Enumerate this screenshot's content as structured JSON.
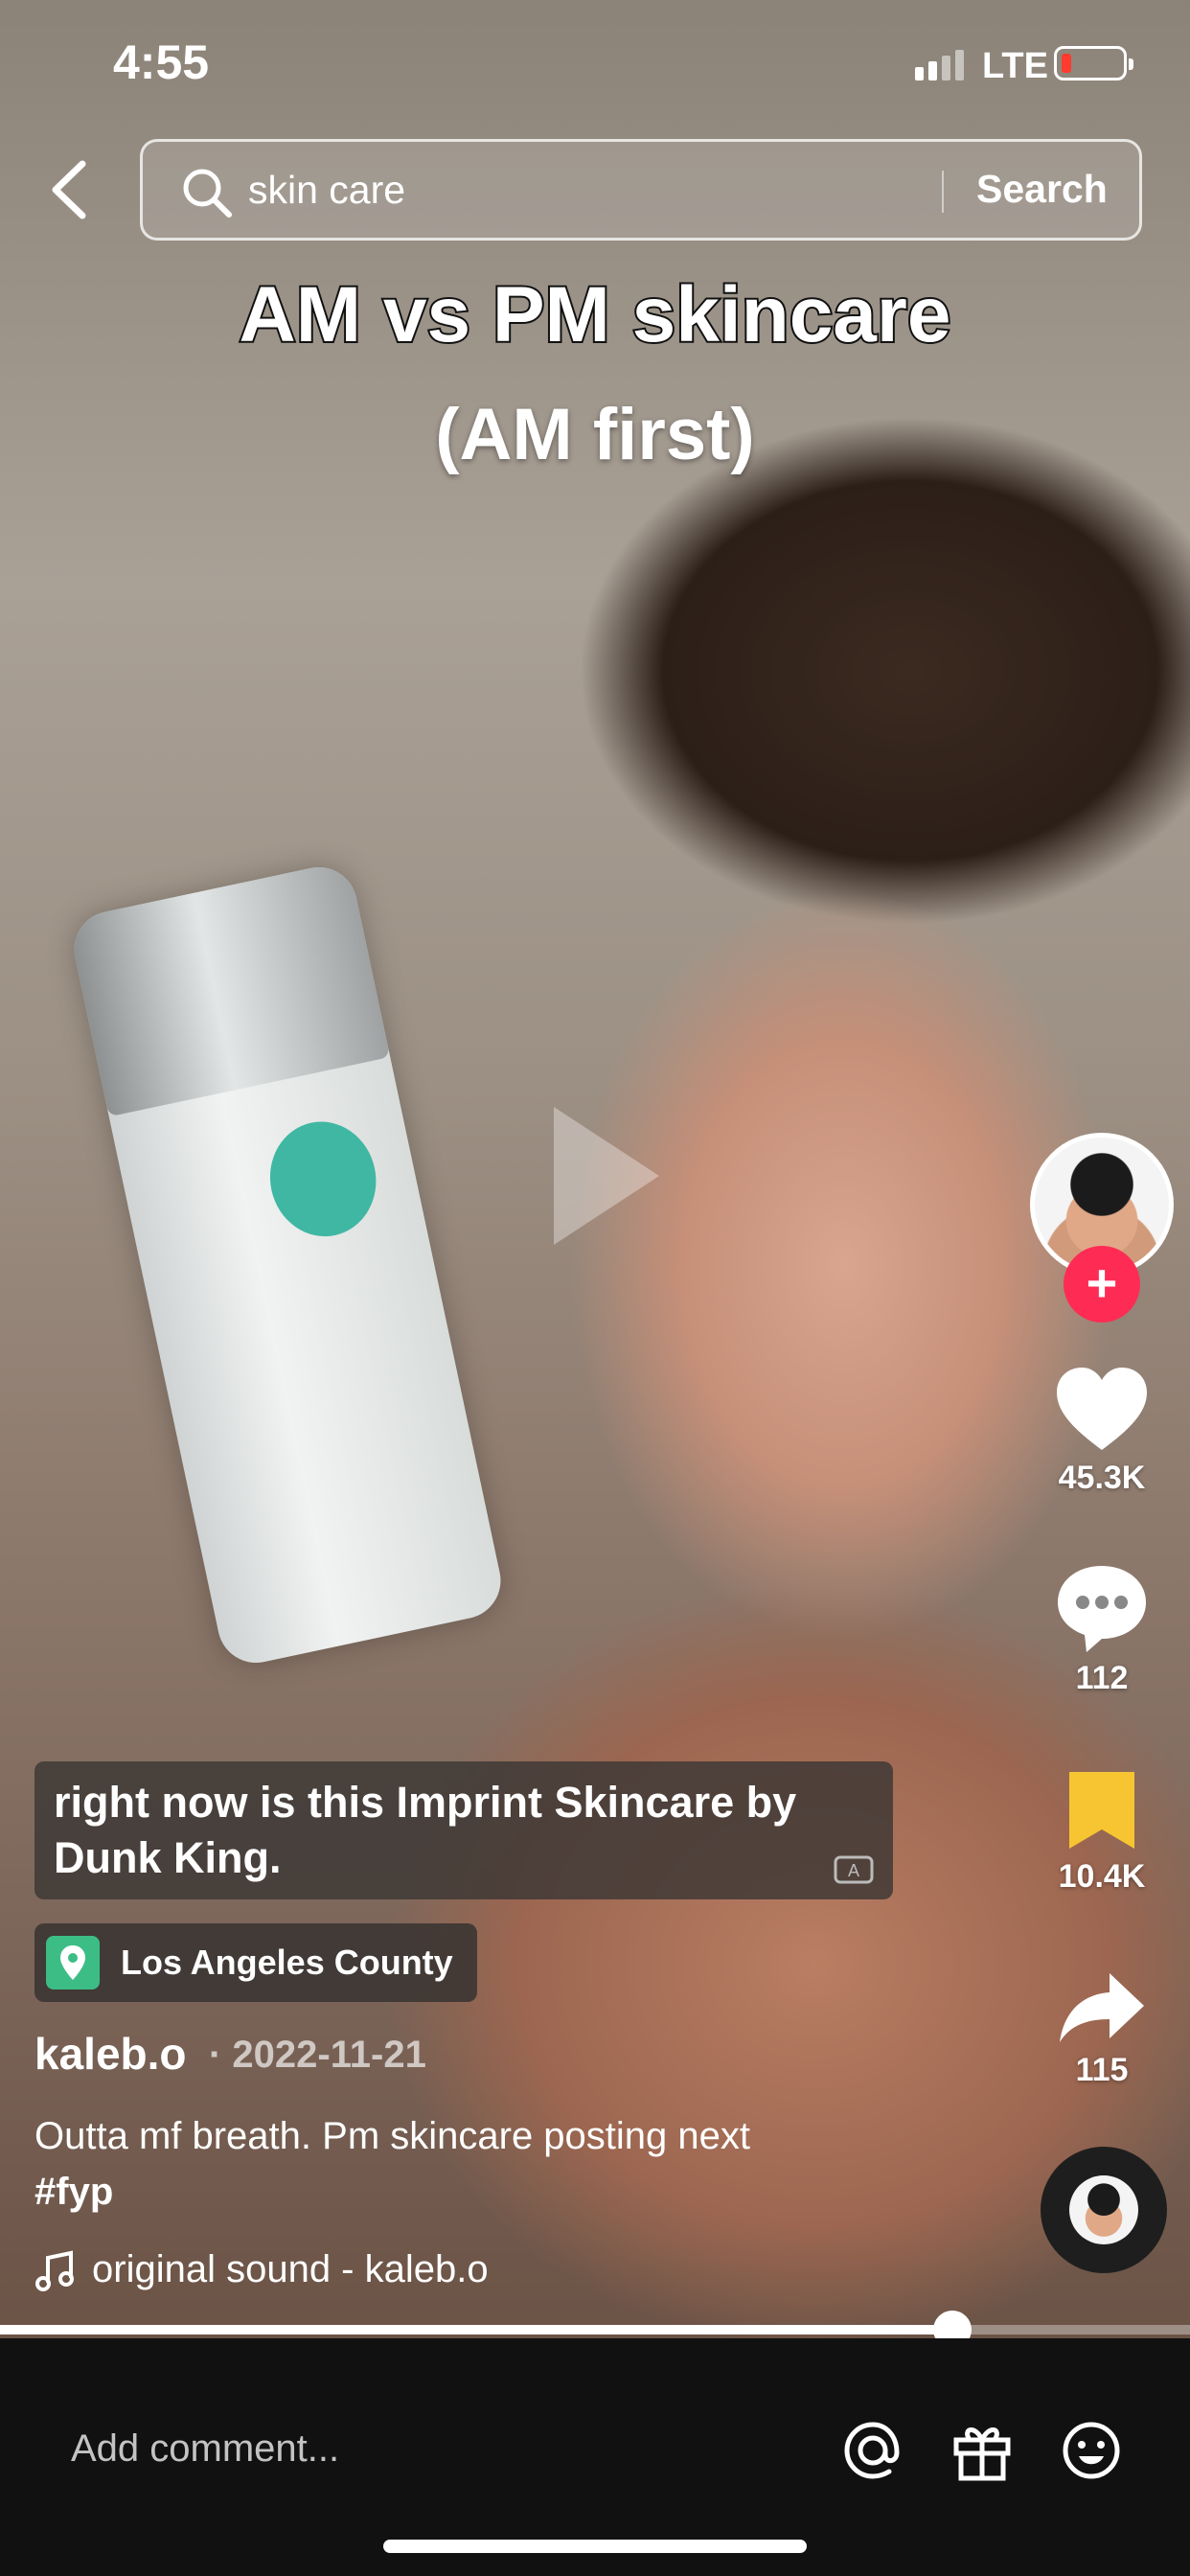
{
  "status_bar": {
    "time": "4:55",
    "network": "LTE",
    "battery_level": 0.1,
    "battery_color": "#ff3b30"
  },
  "search": {
    "query": "skin care",
    "button_label": "Search"
  },
  "video": {
    "overlay_title": "AM vs PM skincare",
    "overlay_subtitle": "(AM first)",
    "progress": 0.8
  },
  "caption": {
    "text": "right now is this Imprint Skincare by Dunk King."
  },
  "location": {
    "name": "Los Angeles County",
    "icon": "location-pin-icon",
    "color": "#3dbd86"
  },
  "post": {
    "username": "kaleb.o",
    "date": "· 2022-11-21",
    "description": "Outta mf breath. Pm skincare posting next",
    "hashtag": "#fyp",
    "sound": "original sound - kaleb.o"
  },
  "actions": {
    "likes": "45.3K",
    "comments": "112",
    "saves": "10.4K",
    "shares": "115",
    "follow_label": "+",
    "accent_color": "#fe2c55",
    "save_color": "#f7c531"
  },
  "comment_bar": {
    "placeholder": "Add comment..."
  }
}
